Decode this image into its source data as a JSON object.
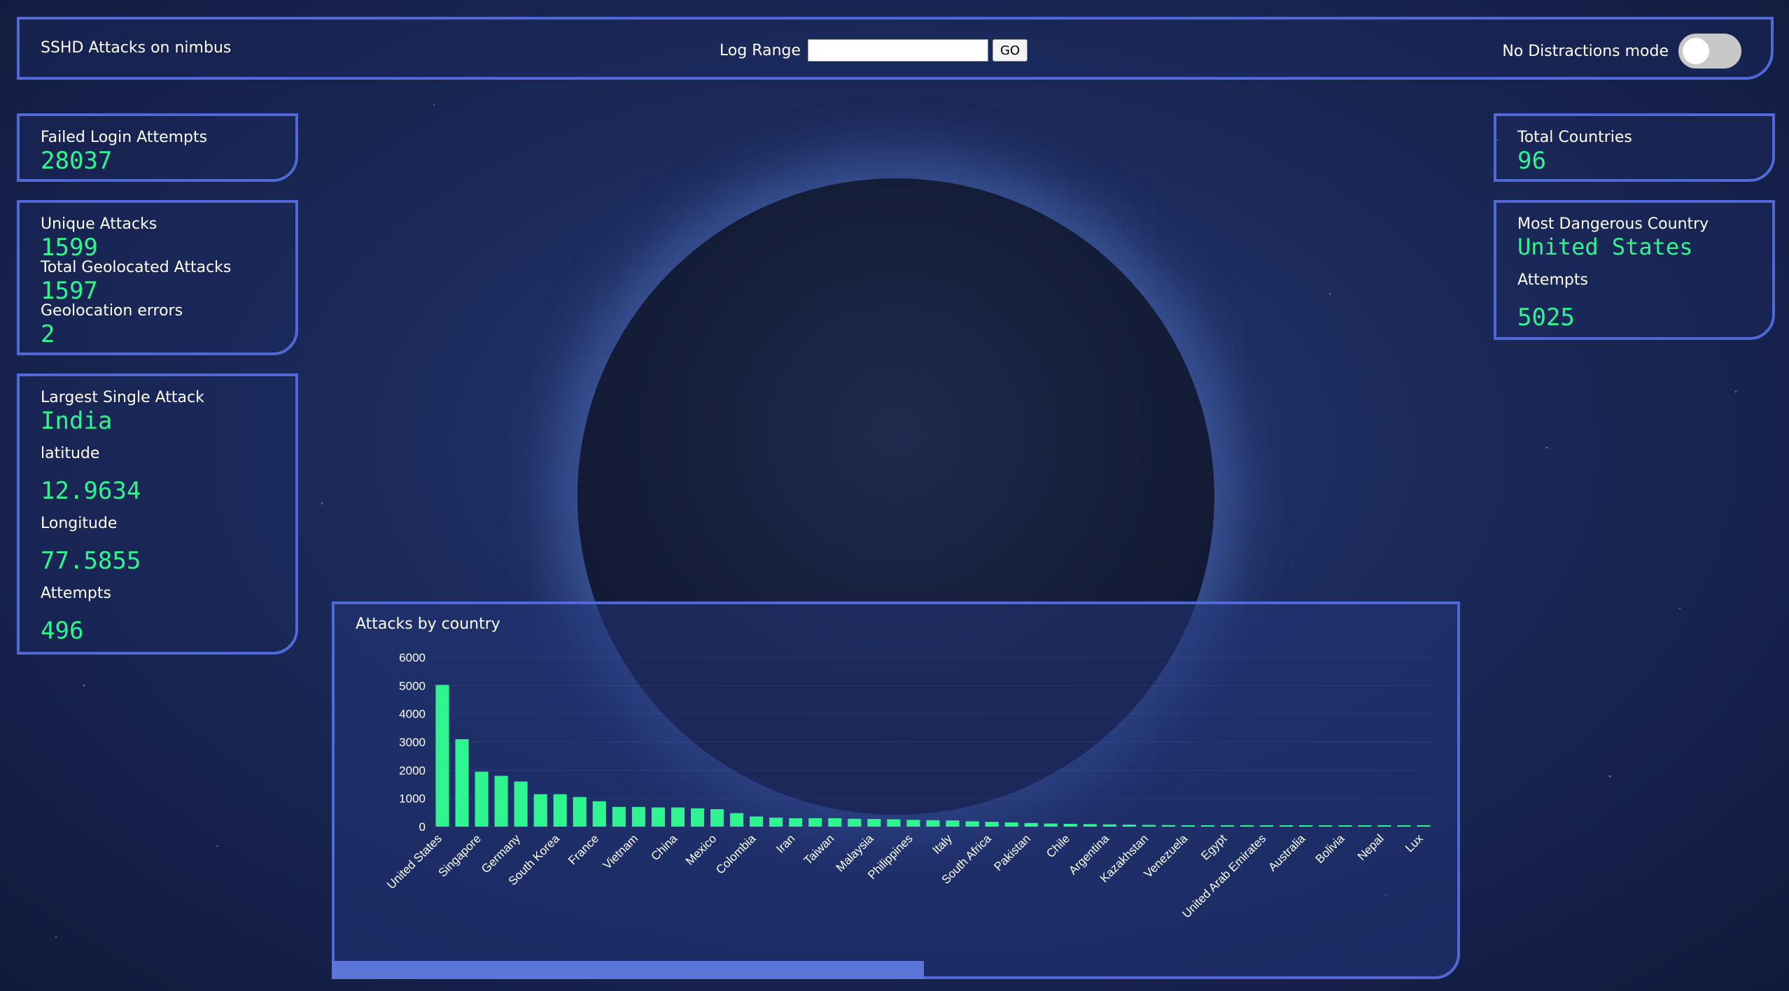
{
  "header": {
    "title": "SSHD Attacks on nimbus",
    "log_range_label": "Log Range",
    "log_range_value": "",
    "go_label": "GO",
    "no_distractions_label": "No Distractions mode",
    "no_distractions_on": false
  },
  "left": {
    "failed_login_label": "Failed Login Attempts",
    "failed_login_value": "28037",
    "unique_attacks_label": "Unique Attacks",
    "unique_attacks_value": "1599",
    "total_geo_label": "Total Geolocated Attacks",
    "total_geo_value": "1597",
    "geo_errors_label": "Geolocation errors",
    "geo_errors_value": "2",
    "largest_label": "Largest Single Attack",
    "largest_country": "India",
    "latitude_label": "latitude",
    "latitude_value": "12.9634",
    "longitude_label": "Longitude",
    "longitude_value": "77.5855",
    "attempts_label": "Attempts",
    "attempts_value": "496"
  },
  "right": {
    "total_countries_label": "Total Countries",
    "total_countries_value": "96",
    "most_dangerous_label": "Most Dangerous Country",
    "most_dangerous_value": "United States",
    "attempts_label": "Attempts",
    "attempts_value": "5025"
  },
  "colors": {
    "accent": "#2ef58f",
    "border": "#5069d6",
    "bar": "#2ef58f"
  },
  "chart_data": {
    "type": "bar",
    "title": "Attacks by country",
    "ylim": [
      0,
      6000
    ],
    "yticks": [
      0,
      1000,
      2000,
      3000,
      4000,
      5000,
      6000
    ],
    "categories": [
      "United States",
      "",
      "Singapore",
      "",
      "Germany",
      "",
      "South Korea",
      "",
      "France",
      "",
      "Vietnam",
      "",
      "China",
      "",
      "Mexico",
      "",
      "Colombia",
      "",
      "Iran",
      "",
      "Taiwan",
      "",
      "Malaysia",
      "",
      "Philippines",
      "",
      "Italy",
      "",
      "South Africa",
      "",
      "Pakistan",
      "",
      "Chile",
      "",
      "Argentina",
      "",
      "Kazakhstan",
      "",
      "Venezuela",
      "",
      "Egypt",
      "",
      "United Arab Emirates",
      "",
      "Australia",
      "",
      "Bolivia",
      "",
      "Nepal",
      ""
    ],
    "tick_labels": [
      "United States",
      "Singapore",
      "Germany",
      "South Korea",
      "France",
      "Vietnam",
      "China",
      "Mexico",
      "Colombia",
      "Iran",
      "Taiwan",
      "Malaysia",
      "Philippines",
      "Italy",
      "South Africa",
      "Pakistan",
      "Chile",
      "Argentina",
      "Kazakhstan",
      "Venezuela",
      "Egypt",
      "United Arab Emirates",
      "Australia",
      "Bolivia",
      "Nepal",
      "Lux"
    ],
    "values": [
      5025,
      3100,
      1950,
      1800,
      1600,
      1150,
      1150,
      1050,
      900,
      700,
      700,
      680,
      680,
      650,
      620,
      480,
      360,
      320,
      300,
      300,
      300,
      280,
      270,
      260,
      240,
      230,
      220,
      190,
      170,
      150,
      130,
      110,
      100,
      90,
      80,
      70,
      60,
      55,
      50,
      45,
      40,
      35,
      30,
      30,
      25,
      25,
      20,
      20,
      15,
      15,
      12
    ]
  }
}
